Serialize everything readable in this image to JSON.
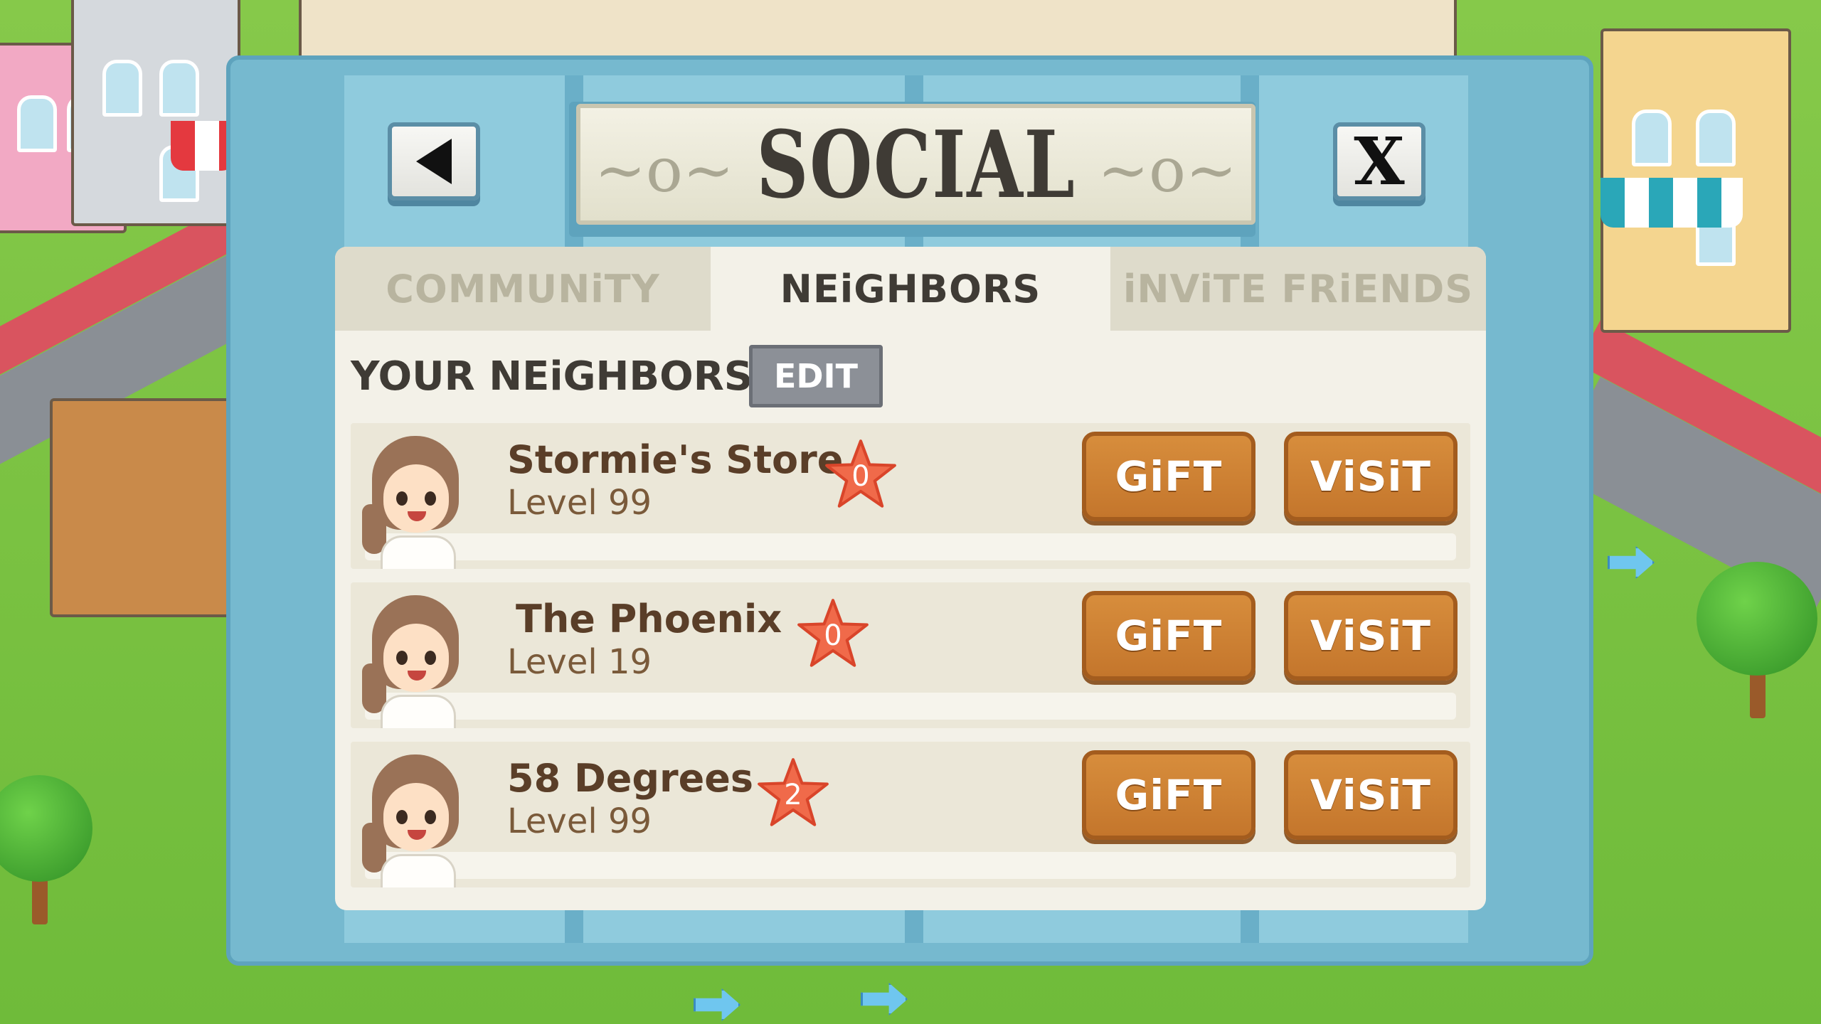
{
  "title": "SOCIAL",
  "tabs": [
    {
      "label": "COMMUNiTY",
      "active": false
    },
    {
      "label": "NEiGHBORS",
      "active": true
    },
    {
      "label": "iNViTE FRiENDS",
      "active": false
    }
  ],
  "section_title": "YOUR NEiGHBORS",
  "edit_label": "EDIT",
  "neighbors": [
    {
      "name": "Stormie's Store",
      "level": "Level 99",
      "star_count": "0",
      "gift_label": "GiFT",
      "visit_label": "ViSiT"
    },
    {
      "name": "The Phoenix",
      "level": "Level 19",
      "star_count": "0",
      "gift_label": "GiFT",
      "visit_label": "ViSiT"
    },
    {
      "name": "58 Degrees",
      "level": "Level 99",
      "star_count": "2",
      "gift_label": "GiFT",
      "visit_label": "ViSiT"
    }
  ],
  "icons": {
    "back": "back-arrow-icon",
    "close": "close-icon",
    "star": "star-icon"
  },
  "colors": {
    "accent_button": "#c97c30",
    "panel": "#f3f1e8",
    "frame": "#76b9cf",
    "star": "#f06a4a"
  }
}
